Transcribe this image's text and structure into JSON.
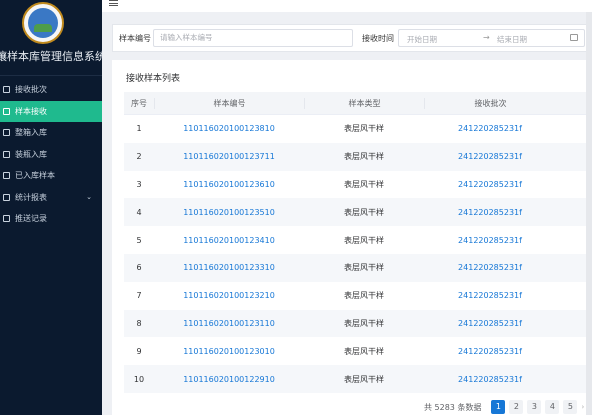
{
  "sidebar": {
    "logo_text": "土壤样本库",
    "system_title": "壤样本库管理信息系统",
    "items": [
      {
        "label": "接收批次",
        "icon": "document-icon",
        "active": false
      },
      {
        "label": "样本接收",
        "icon": "document-icon",
        "active": true
      },
      {
        "label": "整箱入库",
        "icon": "box-icon",
        "active": false
      },
      {
        "label": "装瓶入库",
        "icon": "bottle-icon",
        "active": false
      },
      {
        "label": "已入库样本",
        "icon": "document-icon",
        "active": false
      },
      {
        "label": "统计报表",
        "icon": "chart-icon",
        "active": false,
        "has_submenu": true
      },
      {
        "label": "推送记录",
        "icon": "document-icon",
        "active": false
      }
    ]
  },
  "filter": {
    "sample_no_label": "样本编号",
    "sample_no_placeholder": "请输入样本编号",
    "receive_time_label": "接收时间",
    "start_placeholder": "开始日期",
    "arrow": "→",
    "end_placeholder": "结束日期"
  },
  "table": {
    "title": "接收样本列表",
    "headers": [
      "序号",
      "样本编号",
      "样本类型",
      "接收批次"
    ],
    "rows": [
      {
        "idx": "1",
        "sample_no": "110116020100123810",
        "type": "表层风干样",
        "batch": "241220285231f"
      },
      {
        "idx": "2",
        "sample_no": "110116020100123711",
        "type": "表层风干样",
        "batch": "241220285231f"
      },
      {
        "idx": "3",
        "sample_no": "110116020100123610",
        "type": "表层风干样",
        "batch": "241220285231f"
      },
      {
        "idx": "4",
        "sample_no": "110116020100123510",
        "type": "表层风干样",
        "batch": "241220285231f"
      },
      {
        "idx": "5",
        "sample_no": "110116020100123410",
        "type": "表层风干样",
        "batch": "241220285231f"
      },
      {
        "idx": "6",
        "sample_no": "110116020100123310",
        "type": "表层风干样",
        "batch": "241220285231f"
      },
      {
        "idx": "7",
        "sample_no": "110116020100123210",
        "type": "表层风干样",
        "batch": "241220285231f"
      },
      {
        "idx": "8",
        "sample_no": "110116020100123110",
        "type": "表层风干样",
        "batch": "241220285231f"
      },
      {
        "idx": "9",
        "sample_no": "110116020100123010",
        "type": "表层风干样",
        "batch": "241220285231f"
      },
      {
        "idx": "10",
        "sample_no": "110116020100122910",
        "type": "表层风干样",
        "batch": "241220285231f"
      }
    ]
  },
  "pagination": {
    "total_text": "共 5283 条数据",
    "pages": [
      "1",
      "2",
      "3",
      "4",
      "5"
    ],
    "current": "1",
    "next": "›"
  },
  "colors": {
    "sidebar_bg": "#0b1a2f",
    "active_item": "#1fba8e",
    "link": "#1677d6"
  }
}
